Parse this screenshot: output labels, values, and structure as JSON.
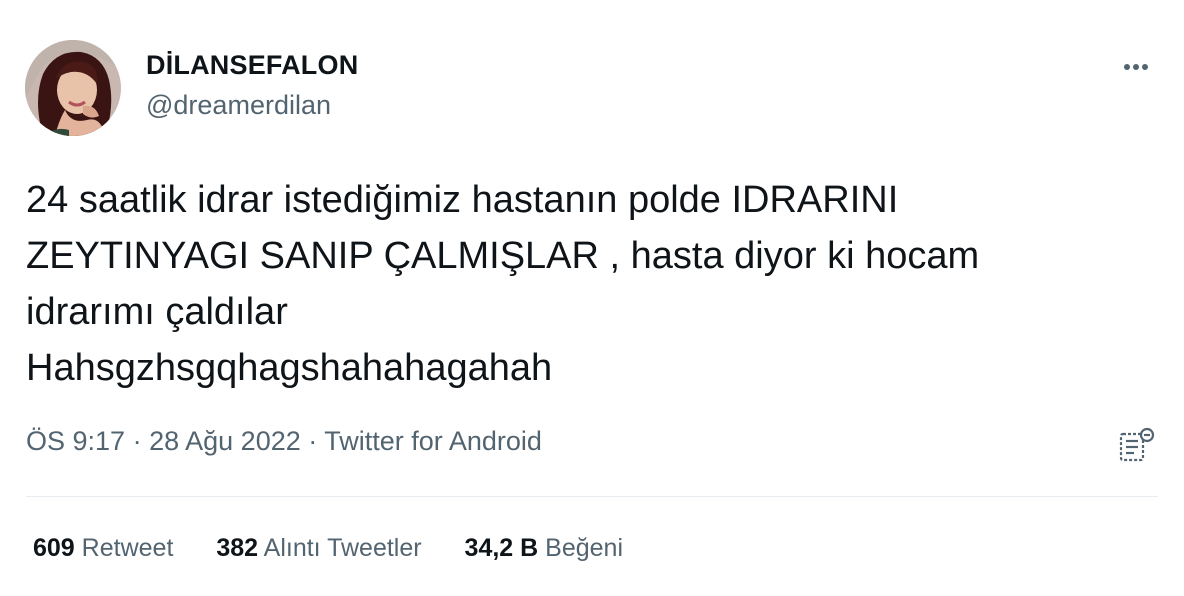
{
  "user": {
    "display_name": "DİLANSEFALON",
    "handle": "@dreamerdilan"
  },
  "tweet": {
    "lines": [
      "24 saatlik idrar istediğimiz hastanın polde IDRARINI",
      "ZEYTINYAGI SANIP ÇALMIŞLAR , hasta diyor ki hocam",
      "idrarımı çaldılar",
      "Hahsgzhsgqhagshahahagahah"
    ]
  },
  "meta": {
    "time": "ÖS 9:17",
    "separator": "·",
    "date": "28 Ağu 2022",
    "source": "Twitter for Android"
  },
  "stats": [
    {
      "count": "609",
      "label": "Retweet"
    },
    {
      "count": "382",
      "label": "Alıntı Tweetler"
    },
    {
      "count": "34,2 B",
      "label": "Beğeni"
    }
  ],
  "icons": {
    "more": "more-horizontal-icon",
    "analytics": "analytics-icon"
  },
  "colors": {
    "text_primary": "#0f1419",
    "text_secondary": "#536471",
    "divider": "#e6ecf0"
  }
}
